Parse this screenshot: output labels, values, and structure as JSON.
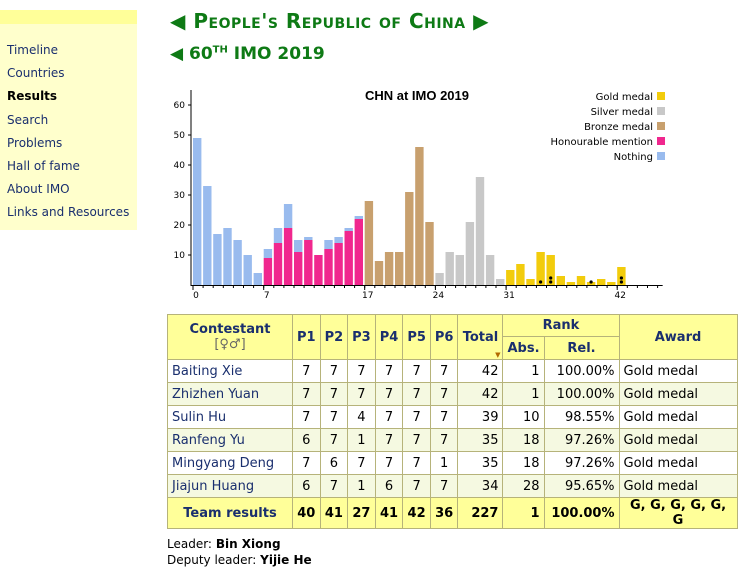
{
  "sidebar": {
    "items": [
      {
        "label": "Timeline",
        "active": false
      },
      {
        "label": "Countries",
        "active": false
      },
      {
        "label": "Results",
        "active": true
      },
      {
        "label": "Search",
        "active": false
      },
      {
        "label": "Problems",
        "active": false
      },
      {
        "label": "Hall of fame",
        "active": false
      },
      {
        "label": "About IMO",
        "active": false
      },
      {
        "label": "Links and Resources",
        "active": false
      }
    ]
  },
  "header": {
    "country_arrow_left": "◀",
    "country": "People's Republic of China",
    "country_arrow_right": "▶",
    "imo_arrow_left": "◀",
    "imo_number": "60",
    "imo_suffix": "TH",
    "imo_rest": "IMO 2019"
  },
  "colors": {
    "gold": "#f2cc0c",
    "silver": "#c8c8c8",
    "bronze": "#c8a06e",
    "honourable": "#f0278e",
    "nothing": "#99bbee",
    "heading_green": "#0e7a15"
  },
  "chart_data": {
    "type": "bar",
    "title": "CHN at IMO 2019",
    "x_ticks": [
      0,
      7,
      17,
      24,
      31,
      42
    ],
    "ylim": [
      0,
      65
    ],
    "y_ticks": [
      10,
      20,
      30,
      40,
      50,
      60
    ],
    "legend_position": "top-right",
    "legend": [
      {
        "name": "Gold medal",
        "key": "gold"
      },
      {
        "name": "Silver medal",
        "key": "silver"
      },
      {
        "name": "Bronze medal",
        "key": "bronze"
      },
      {
        "name": "Honourable mention",
        "key": "honourable"
      },
      {
        "name": "Nothing",
        "key": "nothing"
      }
    ],
    "bars": [
      {
        "x": 0,
        "segments": [
          {
            "v": 49,
            "c": "nothing"
          }
        ]
      },
      {
        "x": 1,
        "segments": [
          {
            "v": 33,
            "c": "nothing"
          }
        ]
      },
      {
        "x": 2,
        "segments": [
          {
            "v": 17,
            "c": "nothing"
          }
        ]
      },
      {
        "x": 3,
        "segments": [
          {
            "v": 19,
            "c": "nothing"
          }
        ]
      },
      {
        "x": 4,
        "segments": [
          {
            "v": 15,
            "c": "nothing"
          }
        ]
      },
      {
        "x": 5,
        "segments": [
          {
            "v": 10,
            "c": "nothing"
          }
        ]
      },
      {
        "x": 6,
        "segments": [
          {
            "v": 4,
            "c": "nothing"
          }
        ]
      },
      {
        "x": 7,
        "segments": [
          {
            "v": 9,
            "c": "honourable"
          },
          {
            "v": 3,
            "c": "nothing"
          }
        ]
      },
      {
        "x": 8,
        "segments": [
          {
            "v": 14,
            "c": "honourable"
          },
          {
            "v": 5,
            "c": "nothing"
          }
        ]
      },
      {
        "x": 9,
        "segments": [
          {
            "v": 19,
            "c": "honourable"
          },
          {
            "v": 8,
            "c": "nothing"
          }
        ]
      },
      {
        "x": 10,
        "segments": [
          {
            "v": 11,
            "c": "honourable"
          },
          {
            "v": 4,
            "c": "nothing"
          }
        ]
      },
      {
        "x": 11,
        "segments": [
          {
            "v": 15,
            "c": "honourable"
          },
          {
            "v": 1,
            "c": "nothing"
          }
        ]
      },
      {
        "x": 12,
        "segments": [
          {
            "v": 10,
            "c": "honourable"
          }
        ]
      },
      {
        "x": 13,
        "segments": [
          {
            "v": 12,
            "c": "honourable"
          },
          {
            "v": 3,
            "c": "nothing"
          }
        ]
      },
      {
        "x": 14,
        "segments": [
          {
            "v": 14,
            "c": "honourable"
          },
          {
            "v": 2,
            "c": "nothing"
          }
        ]
      },
      {
        "x": 15,
        "segments": [
          {
            "v": 18,
            "c": "honourable"
          },
          {
            "v": 1,
            "c": "nothing"
          }
        ]
      },
      {
        "x": 16,
        "segments": [
          {
            "v": 22,
            "c": "honourable"
          },
          {
            "v": 1,
            "c": "nothing"
          }
        ]
      },
      {
        "x": 17,
        "segments": [
          {
            "v": 28,
            "c": "bronze"
          }
        ]
      },
      {
        "x": 18,
        "segments": [
          {
            "v": 8,
            "c": "bronze"
          }
        ]
      },
      {
        "x": 19,
        "segments": [
          {
            "v": 11,
            "c": "bronze"
          }
        ]
      },
      {
        "x": 20,
        "segments": [
          {
            "v": 11,
            "c": "bronze"
          }
        ]
      },
      {
        "x": 21,
        "segments": [
          {
            "v": 31,
            "c": "bronze"
          }
        ]
      },
      {
        "x": 22,
        "segments": [
          {
            "v": 46,
            "c": "bronze"
          }
        ]
      },
      {
        "x": 23,
        "segments": [
          {
            "v": 21,
            "c": "bronze"
          }
        ]
      },
      {
        "x": 24,
        "segments": [
          {
            "v": 4,
            "c": "silver"
          }
        ]
      },
      {
        "x": 25,
        "segments": [
          {
            "v": 11,
            "c": "silver"
          }
        ]
      },
      {
        "x": 26,
        "segments": [
          {
            "v": 10,
            "c": "silver"
          }
        ]
      },
      {
        "x": 27,
        "segments": [
          {
            "v": 21,
            "c": "silver"
          }
        ]
      },
      {
        "x": 28,
        "segments": [
          {
            "v": 36,
            "c": "silver"
          }
        ]
      },
      {
        "x": 29,
        "segments": [
          {
            "v": 10,
            "c": "silver"
          }
        ]
      },
      {
        "x": 30,
        "segments": [
          {
            "v": 2,
            "c": "silver"
          }
        ]
      },
      {
        "x": 31,
        "segments": [
          {
            "v": 5,
            "c": "gold"
          }
        ]
      },
      {
        "x": 32,
        "segments": [
          {
            "v": 7,
            "c": "gold"
          }
        ]
      },
      {
        "x": 33,
        "segments": [
          {
            "v": 2,
            "c": "gold"
          }
        ]
      },
      {
        "x": 34,
        "segments": [
          {
            "v": 11,
            "c": "gold"
          }
        ]
      },
      {
        "x": 35,
        "segments": [
          {
            "v": 10,
            "c": "gold"
          }
        ]
      },
      {
        "x": 36,
        "segments": [
          {
            "v": 3,
            "c": "gold"
          }
        ]
      },
      {
        "x": 37,
        "segments": [
          {
            "v": 1,
            "c": "gold"
          }
        ]
      },
      {
        "x": 38,
        "segments": [
          {
            "v": 3,
            "c": "gold"
          }
        ]
      },
      {
        "x": 39,
        "segments": [
          {
            "v": 1,
            "c": "gold"
          }
        ]
      },
      {
        "x": 40,
        "segments": [
          {
            "v": 2,
            "c": "gold"
          }
        ]
      },
      {
        "x": 41,
        "segments": [
          {
            "v": 1,
            "c": "gold"
          }
        ]
      },
      {
        "x": 42,
        "segments": [
          {
            "v": 6,
            "c": "gold"
          }
        ]
      }
    ],
    "team_markers": [
      {
        "score": 34,
        "count": 1
      },
      {
        "score": 35,
        "count": 2
      },
      {
        "score": 39,
        "count": 1
      },
      {
        "score": 42,
        "count": 2
      }
    ]
  },
  "table": {
    "headers": {
      "contestant": "Contestant",
      "gender_symbols": "[♀♂]",
      "p1": "P1",
      "p2": "P2",
      "p3": "P3",
      "p4": "P4",
      "p5": "P5",
      "p6": "P6",
      "total": "Total",
      "rank": "Rank",
      "abs": "Abs.",
      "rel": "Rel.",
      "award": "Award"
    },
    "rows": [
      {
        "name": "Baiting Xie",
        "p1": "7",
        "p2": "7",
        "p3": "7",
        "p4": "7",
        "p5": "7",
        "p6": "7",
        "total": "42",
        "abs": "1",
        "rel": "100.00%",
        "award": "Gold medal"
      },
      {
        "name": "Zhizhen Yuan",
        "p1": "7",
        "p2": "7",
        "p3": "7",
        "p4": "7",
        "p5": "7",
        "p6": "7",
        "total": "42",
        "abs": "1",
        "rel": "100.00%",
        "award": "Gold medal"
      },
      {
        "name": "Sulin Hu",
        "p1": "7",
        "p2": "7",
        "p3": "4",
        "p4": "7",
        "p5": "7",
        "p6": "7",
        "total": "39",
        "abs": "10",
        "rel": "98.55%",
        "award": "Gold medal"
      },
      {
        "name": "Ranfeng Yu",
        "p1": "6",
        "p2": "7",
        "p3": "1",
        "p4": "7",
        "p5": "7",
        "p6": "7",
        "total": "35",
        "abs": "18",
        "rel": "97.26%",
        "award": "Gold medal"
      },
      {
        "name": "Mingyang Deng",
        "p1": "7",
        "p2": "6",
        "p3": "7",
        "p4": "7",
        "p5": "7",
        "p6": "1",
        "total": "35",
        "abs": "18",
        "rel": "97.26%",
        "award": "Gold medal"
      },
      {
        "name": "Jiajun Huang",
        "p1": "6",
        "p2": "7",
        "p3": "1",
        "p4": "6",
        "p5": "7",
        "p6": "7",
        "total": "34",
        "abs": "28",
        "rel": "95.65%",
        "award": "Gold medal"
      }
    ],
    "team": {
      "label": "Team results",
      "p1": "40",
      "p2": "41",
      "p3": "27",
      "p4": "41",
      "p5": "42",
      "p6": "36",
      "total": "227",
      "abs": "1",
      "rel": "100.00%",
      "award": "G, G, G, G, G, G"
    }
  },
  "leaders": {
    "leader_label": "Leader:",
    "leader_name": "Bin Xiong",
    "deputy_label": "Deputy leader:",
    "deputy_name": "Yijie He"
  }
}
